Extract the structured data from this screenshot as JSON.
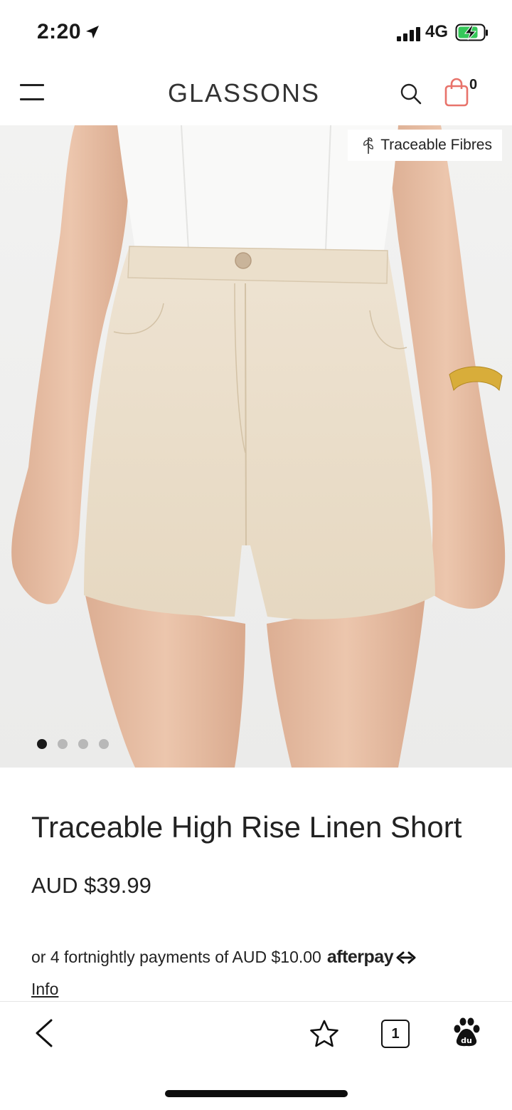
{
  "status": {
    "time": "2:20",
    "network": "4G"
  },
  "header": {
    "logo": "GLASSONS",
    "cart_count": "0"
  },
  "hero": {
    "badge": "Traceable Fibres",
    "slide_count": 4,
    "active_slide": 1
  },
  "product": {
    "title": "Traceable High Rise Linen Short",
    "price": "AUD $39.99",
    "installments": "or 4 fortnightly payments of AUD $10.00",
    "afterpay_brand": "afterpay",
    "info_link": "Info"
  },
  "browser": {
    "tab_count": "1"
  },
  "colors": {
    "cart_accent": "#e8736b",
    "battery_charge": "#35c759",
    "shorts": "#e9dcc7",
    "skin": "#e7bba0"
  },
  "icons": [
    "location-arrow-icon",
    "signal-icon",
    "battery-charging-icon",
    "menu-icon",
    "search-icon",
    "shopping-bag-icon",
    "leaf-icon",
    "afterpay-logo-icon",
    "back-chevron-icon",
    "star-icon",
    "tabs-icon",
    "baidu-paw-icon"
  ]
}
